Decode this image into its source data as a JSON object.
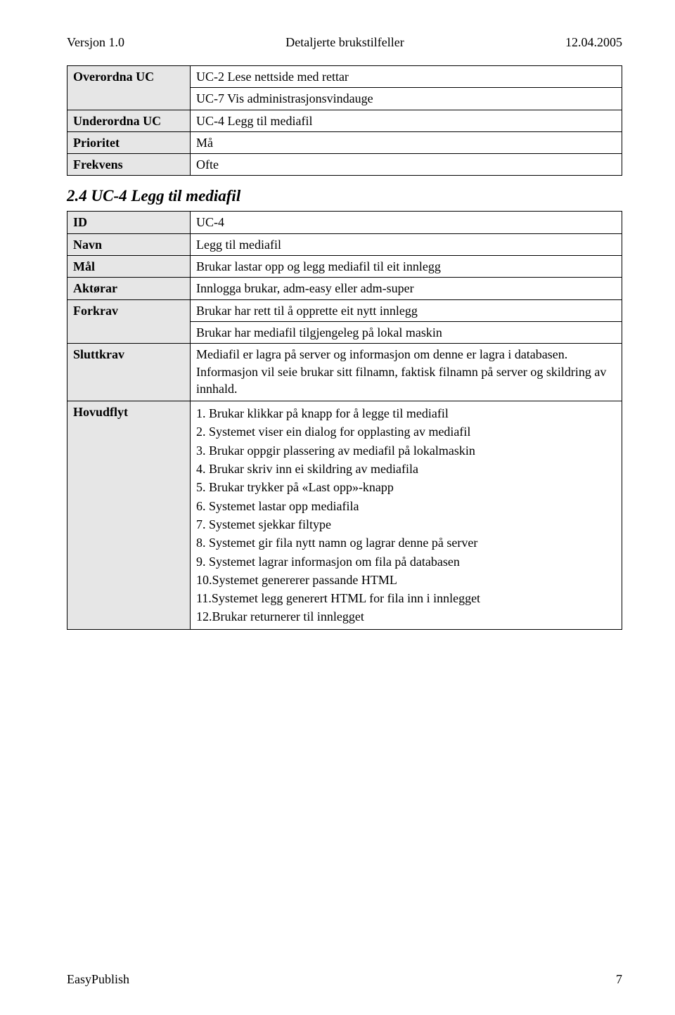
{
  "header": {
    "left": "Versjon 1.0",
    "center": "Detaljerte brukstilfeller",
    "right": "12.04.2005"
  },
  "table1": {
    "rows": [
      {
        "label": "Overordna UC",
        "values": [
          "UC-2 Lese nettside med rettar",
          "UC-7 Vis administrasjonsvindauge"
        ]
      },
      {
        "label": "Underordna UC",
        "values": [
          "UC-4 Legg til mediafil"
        ]
      },
      {
        "label": "Prioritet",
        "values": [
          "Må"
        ]
      },
      {
        "label": "Frekvens",
        "values": [
          "Ofte"
        ]
      }
    ]
  },
  "section2": {
    "heading": "2.4 UC-4 Legg til mediafil"
  },
  "table2": {
    "id_label": "ID",
    "id_value": "UC-4",
    "navn_label": "Navn",
    "navn_value": "Legg til mediafil",
    "mal_label": "Mål",
    "mal_value": "Brukar lastar opp og legg mediafil til eit innlegg",
    "aktorar_label": "Aktørar",
    "aktorar_value": "Innlogga brukar, adm-easy eller adm-super",
    "forkrav_label": "Forkrav",
    "forkrav_values": [
      "Brukar har rett til å opprette eit nytt innlegg",
      "Brukar har mediafil tilgjengeleg på lokal maskin"
    ],
    "sluttkrav_label": "Sluttkrav",
    "sluttkrav_value": "Mediafil er lagra på server og informasjon om denne er lagra i databasen. Informasjon vil seie brukar sitt filnamn, faktisk filnamn på server og skildring av innhald.",
    "hovudflyt_label": "Hovudflyt",
    "hovudflyt_items": [
      "1. Brukar klikkar på knapp for å legge til mediafil",
      "2. Systemet viser ein dialog for opplasting av mediafil",
      "3. Brukar oppgir plassering av mediafil på lokalmaskin",
      "4. Brukar skriv inn ei skildring av mediafila",
      "5. Brukar trykker på «Last opp»-knapp",
      "6. Systemet lastar opp mediafila",
      "7. Systemet sjekkar filtype",
      "8. Systemet gir fila nytt namn og lagrar denne på server",
      "9. Systemet lagrar informasjon om fila på databasen",
      "10.Systemet genererer passande HTML",
      "11.Systemet legg generert HTML for fila inn i innlegget",
      "12.Brukar returnerer til innlegget"
    ]
  },
  "footer": {
    "left": "EasyPublish",
    "right": "7"
  }
}
